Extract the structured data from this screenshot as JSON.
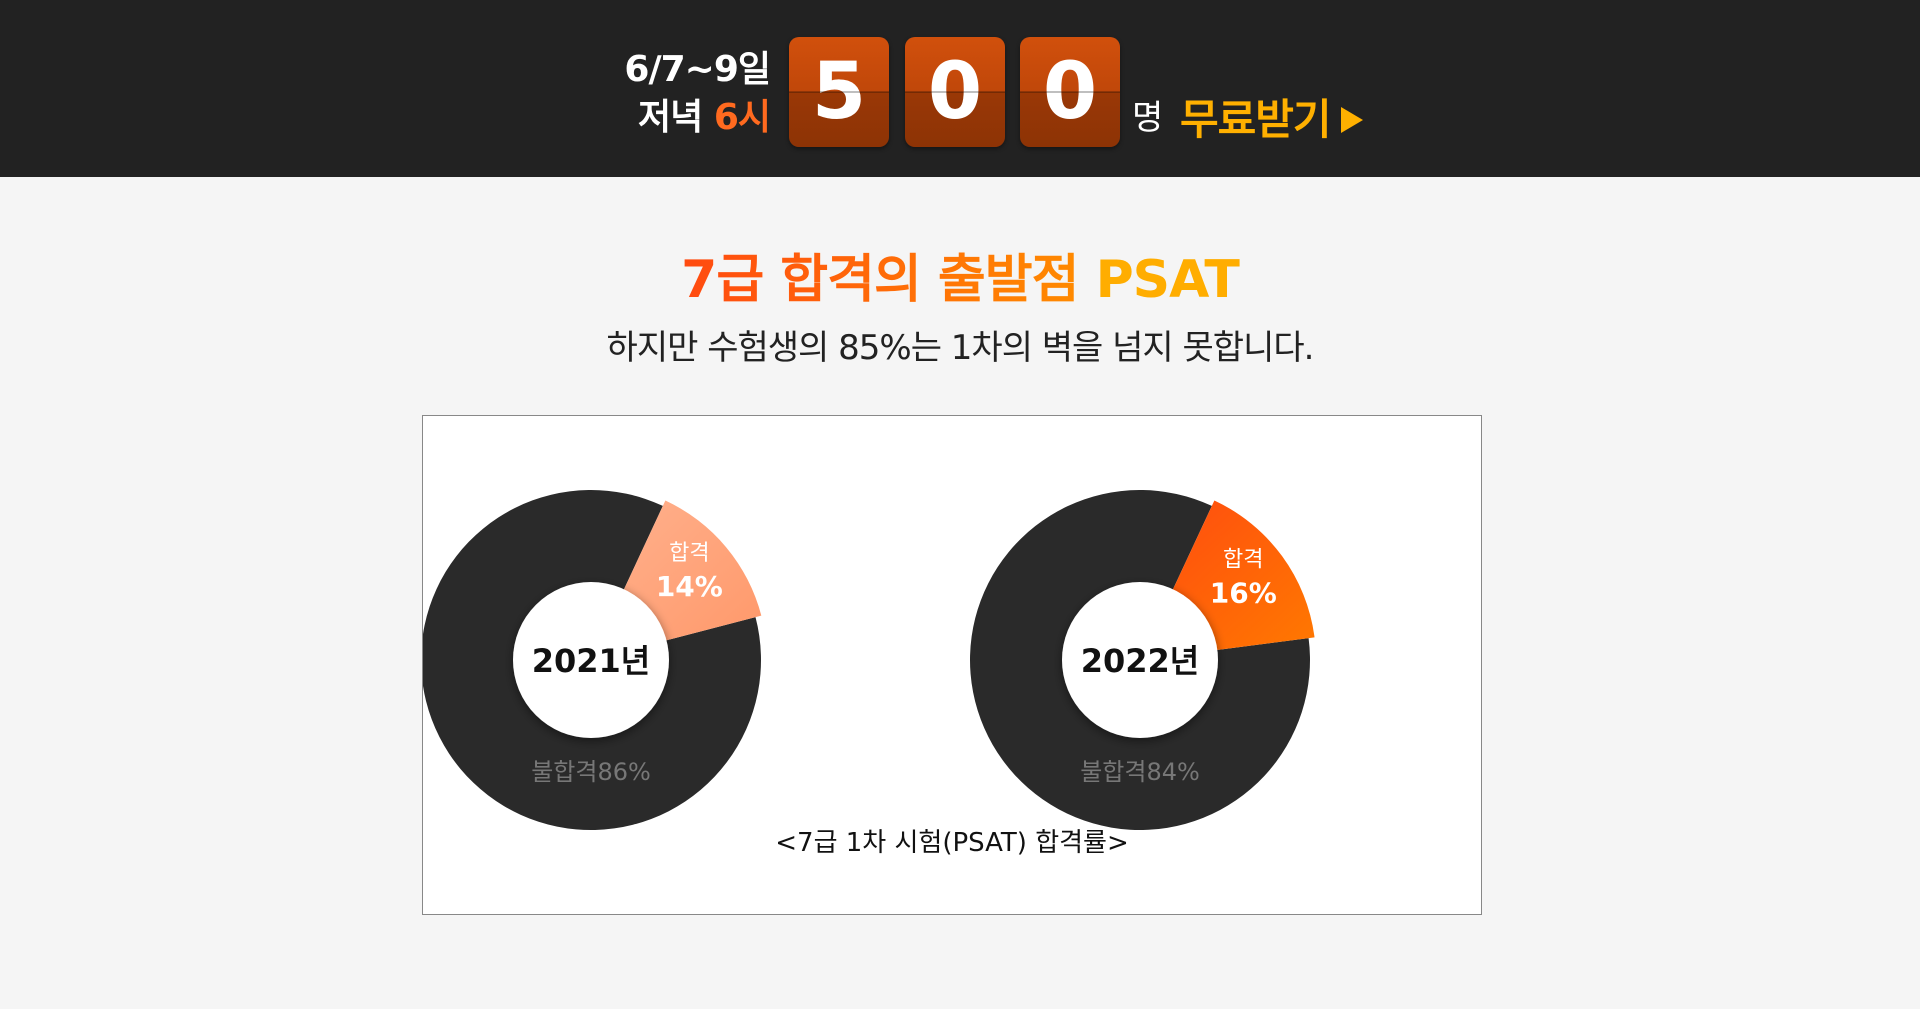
{
  "promo": {
    "date_line": "6/7~9일",
    "time_prefix": "저녁 ",
    "time_highlight": "6시",
    "digits": [
      "5",
      "0",
      "0"
    ],
    "unit": "명",
    "cta_label": "무료받기",
    "cta_icon": "play-triangle-icon"
  },
  "heading": {
    "part1": "7급 합격의 출발점",
    "part2": "PSAT"
  },
  "subheading": "하지만 수험생의 85%는 1차의 벽을 넘지 못합니다.",
  "colors": {
    "banner_bg": "#222222",
    "accent": "#ff6a1f",
    "cta": "#ffb000",
    "fail_slice": "#2a2a2a",
    "pass_2021": "#ffa07a",
    "pass_2022": "#ff5a10"
  },
  "chart_data": {
    "type": "pie",
    "caption": "<7급 1차 시험(PSAT) 합격률>",
    "charts": [
      {
        "center_label": "2021년",
        "slices": [
          {
            "label": "합격",
            "value": 14,
            "display": "14%"
          },
          {
            "label": "불합격",
            "value": 86,
            "display": "86%"
          }
        ]
      },
      {
        "center_label": "2022년",
        "slices": [
          {
            "label": "합격",
            "value": 16,
            "display": "16%"
          },
          {
            "label": "불합격",
            "value": 84,
            "display": "84%"
          }
        ]
      }
    ]
  }
}
